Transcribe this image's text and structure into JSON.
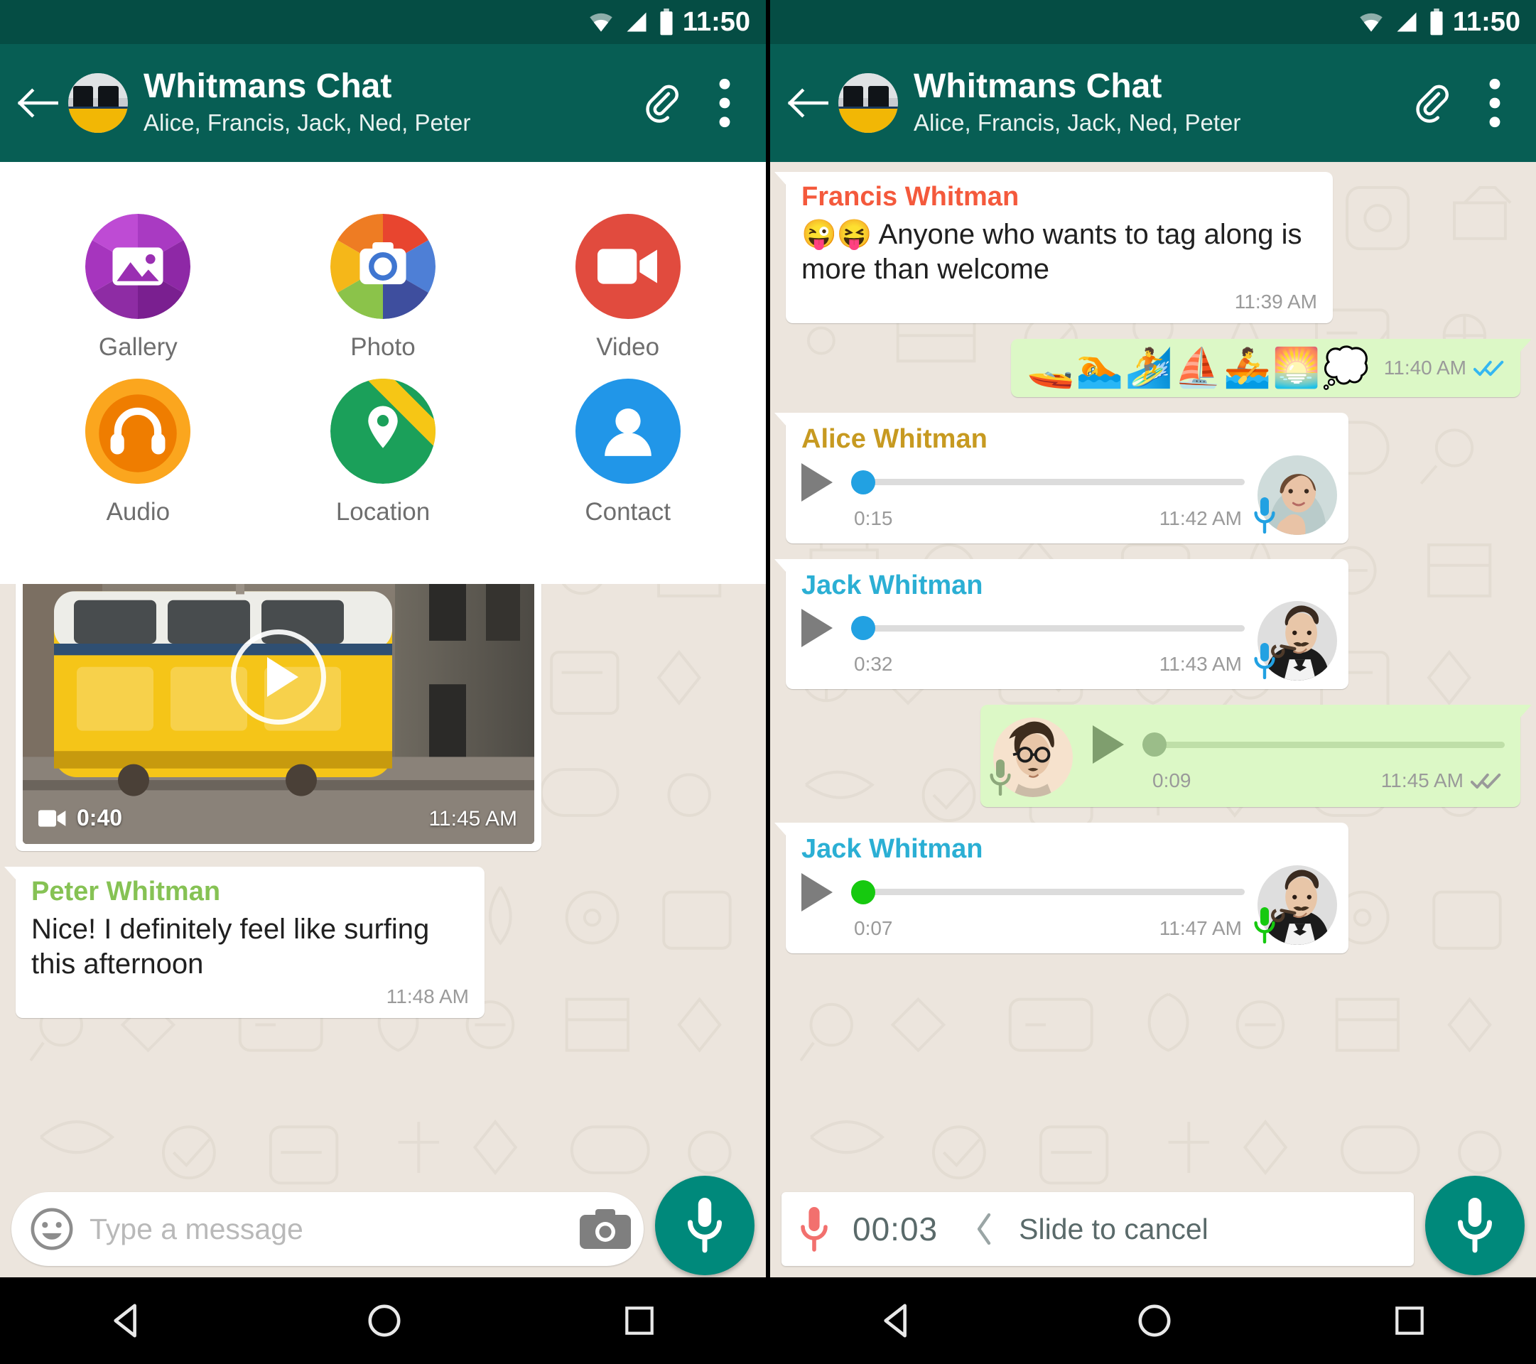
{
  "status_bar": {
    "time": "11:50",
    "icons": [
      "wifi-icon",
      "signal-icon",
      "battery-icon"
    ]
  },
  "header": {
    "title": "Whitmans Chat",
    "subtitle": "Alice, Francis, Jack, Ned, Peter",
    "back_icon": "back-arrow-icon",
    "attach_icon": "paperclip-icon",
    "overflow_icon": "more-vertical-icon"
  },
  "colors": {
    "appbar": "#075E54",
    "statusbar": "#054D44",
    "chat_bg": "#ECE5DD",
    "outgoing_bubble": "#DCF8C6",
    "incoming_bubble": "#FFFFFF",
    "fab": "#00897B",
    "tick_blue": "#34B7F1",
    "record_red": "#F2706E",
    "sender_francis": "#F4593C",
    "sender_alice": "#C79A21",
    "sender_jack": "#2BAFD4",
    "sender_peter": "#86C254"
  },
  "left_screen": {
    "attachment_panel": {
      "items": [
        {
          "label": "Gallery",
          "icon": "gallery-icon",
          "color": "#AB3EC0"
        },
        {
          "label": "Photo",
          "icon": "camera-icon",
          "color": "#EA7C1F"
        },
        {
          "label": "Video",
          "icon": "video-icon",
          "color": "#E14B3E"
        },
        {
          "label": "Audio",
          "icon": "headphones-icon",
          "color": "#F39200"
        },
        {
          "label": "Location",
          "icon": "map-pin-icon",
          "color": "#1BA05A"
        },
        {
          "label": "Contact",
          "icon": "person-icon",
          "color": "#2196E8"
        }
      ]
    },
    "messages": [
      {
        "type": "video",
        "direction": "in",
        "duration": "0:40",
        "time": "11:45 AM",
        "play_icon": "play-circle-icon",
        "video_icon": "video-camera-icon"
      },
      {
        "type": "text",
        "direction": "in",
        "sender": "Peter Whitman",
        "sender_color": "#86C254",
        "text": "Nice! I definitely feel like surfing this afternoon",
        "time": "11:48 AM"
      }
    ],
    "input_bar": {
      "placeholder": "Type a message",
      "emoji_icon": "smiley-icon",
      "camera_icon": "camera-icon",
      "mic_icon": "microphone-icon"
    }
  },
  "right_screen": {
    "messages": [
      {
        "type": "text",
        "direction": "in",
        "sender": "Francis Whitman",
        "sender_color": "#F4593C",
        "emoji": "😜😝",
        "text": "Anyone who wants to tag along is more than welcome",
        "time": "11:39 AM"
      },
      {
        "type": "emoji",
        "direction": "out",
        "emoji": "🚤🏊🏄⛵🚣🌅💭",
        "time": "11:40 AM",
        "status": "read",
        "tick_icon": "double-check-icon"
      },
      {
        "type": "audio",
        "direction": "in",
        "sender": "Alice Whitman",
        "sender_color": "#C79A21",
        "duration": "0:15",
        "time": "11:42 AM",
        "progress": 0,
        "knob_color": "#22A1E2",
        "avatar": "alice-avatar",
        "play_icon": "play-icon",
        "mic_icon": "microphone-icon"
      },
      {
        "type": "audio",
        "direction": "in",
        "sender": "Jack Whitman",
        "sender_color": "#2BAFD4",
        "duration": "0:32",
        "time": "11:43 AM",
        "progress": 0,
        "knob_color": "#22A1E2",
        "avatar": "jack-avatar",
        "play_icon": "play-icon",
        "mic_icon": "microphone-icon"
      },
      {
        "type": "audio",
        "direction": "out",
        "sender": "",
        "duration": "0:09",
        "time": "11:45 AM",
        "progress": 0,
        "knob_color": "#9bbd89",
        "avatar": "self-avatar",
        "status": "read",
        "tick_icon": "double-check-icon",
        "play_icon": "play-icon",
        "mic_icon": "microphone-icon"
      },
      {
        "type": "audio",
        "direction": "in",
        "sender": "Jack Whitman",
        "sender_color": "#2BAFD4",
        "duration": "0:07",
        "time": "11:47 AM",
        "progress": 0,
        "knob_color": "#16C90F",
        "avatar": "jack-avatar",
        "play_icon": "play-icon",
        "mic_icon": "microphone-icon"
      }
    ],
    "recording_bar": {
      "timer": "00:03",
      "cancel_text": "Slide to cancel",
      "mic_icon": "microphone-recording-icon",
      "chevron_icon": "chevron-left-icon",
      "fab_icon": "microphone-icon"
    }
  },
  "nav_bar": {
    "back": "triangle-back-icon",
    "home": "circle-home-icon",
    "recents": "square-recents-icon"
  }
}
